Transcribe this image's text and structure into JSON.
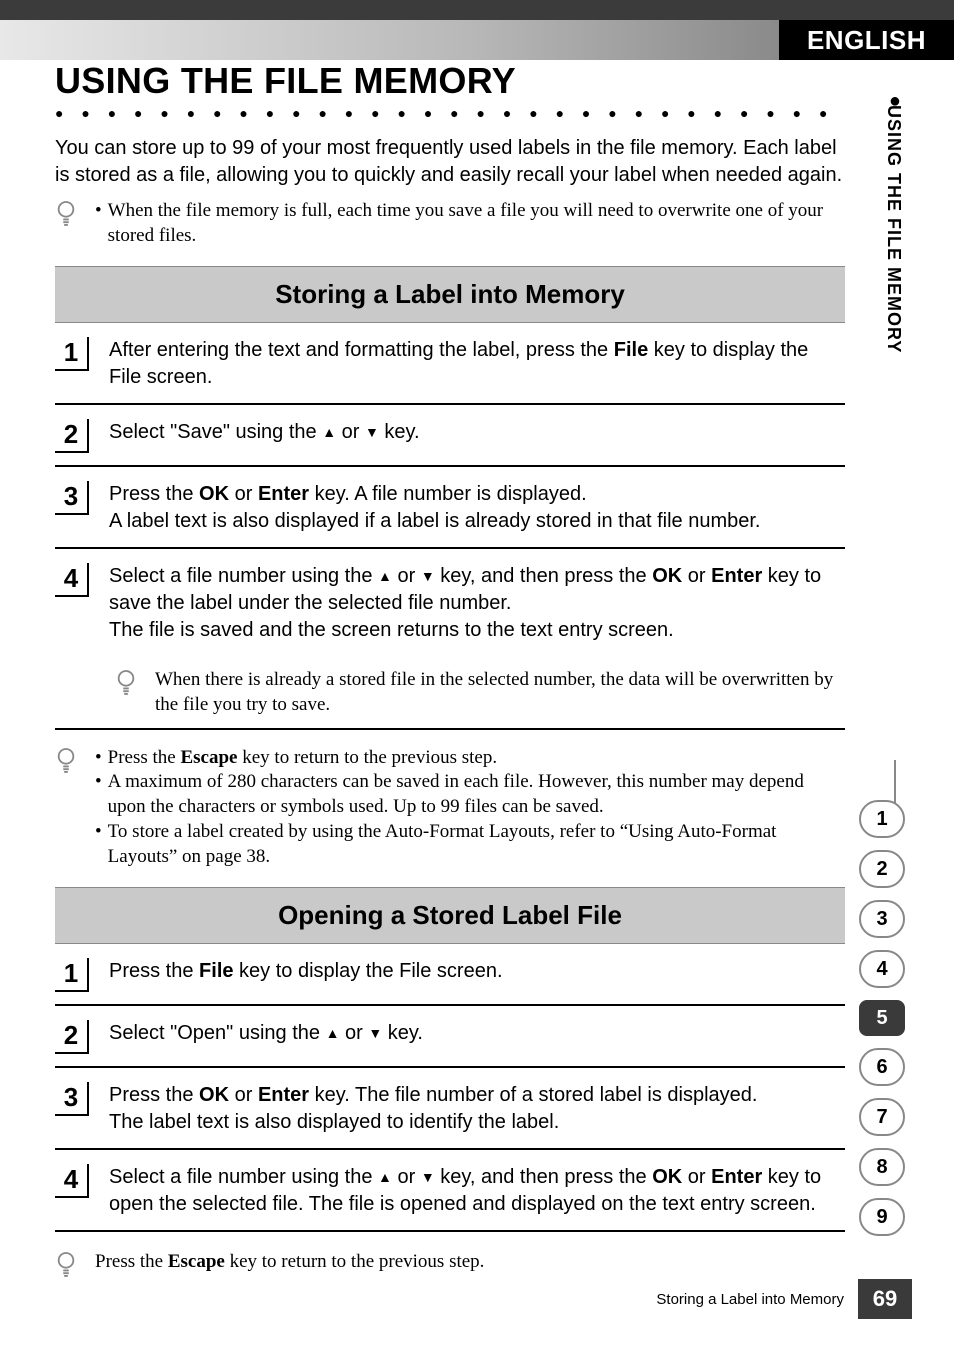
{
  "header": {
    "lang": "ENGLISH",
    "sidebar_label": "USING THE FILE MEMORY"
  },
  "title": "USING THE FILE MEMORY",
  "intro": "You can store up to 99 of your most frequently used labels in the file memory. Each label is stored as a file, allowing you to quickly and easily recall your label when needed again.",
  "intro_note": "When the file memory is full, each time you save a file you will need to overwrite one of your stored files.",
  "sectionA": {
    "title": "Storing a Label into Memory",
    "steps": [
      {
        "n": "1",
        "pre": "After entering the text and formatting the label, press the ",
        "b1": "File",
        "post": " key to display the File screen."
      },
      {
        "n": "2",
        "pre": "Select \"Save\" using the ",
        "mid": " or ",
        "post": " key."
      },
      {
        "n": "3",
        "pre": "Press the ",
        "b1": "OK",
        "mid1": " or ",
        "b2": "Enter",
        "post": " key. A file number is displayed.",
        "line2": "A label text is also displayed if a label is already stored in that file number."
      },
      {
        "n": "4",
        "pre": "Select a file number using the ",
        "mid": " or ",
        "mid2": " key, and then press the ",
        "b1": "OK",
        "mid3": " or ",
        "b2": "Enter",
        "post": " key to save the label under the selected file number.",
        "line2": "The file is saved and the screen returns to the text entry screen."
      }
    ],
    "sub_note": "When there is already a stored file in the selected number, the data will be overwritten by the file you try to save.",
    "end_notes": [
      {
        "pre": "Press the ",
        "b1": "Escape",
        "post": " key to return to the previous step."
      },
      {
        "text": "A maximum of 280 characters can be saved in each file. However, this number may depend upon the characters or symbols used. Up to 99 files can be saved."
      },
      {
        "text": "To store a label created by using the Auto-Format Layouts, refer to “Using Auto-Format Layouts” on page 38."
      }
    ]
  },
  "sectionB": {
    "title": "Opening a Stored Label File",
    "steps": [
      {
        "n": "1",
        "pre": "Press the ",
        "b1": "File",
        "post": " key to display the File screen."
      },
      {
        "n": "2",
        "pre": "Select \"Open\" using the ",
        "mid": " or ",
        "post": " key."
      },
      {
        "n": "3",
        "pre": "Press the ",
        "b1": "OK",
        "mid1": " or ",
        "b2": "Enter",
        "post": " key. The file number of a stored label is displayed.",
        "line2": "The label text is also displayed to identify the label."
      },
      {
        "n": "4",
        "pre": "Select a file number using the ",
        "mid": " or ",
        "mid2": " key, and then press the ",
        "b1": "OK",
        "mid3": " or ",
        "b2": "Enter",
        "post": " key to open the selected file. The file is opened and displayed on the text entry screen."
      }
    ],
    "end_note": {
      "pre": "Press the ",
      "b1": "Escape",
      "post": " key to return to the previous step."
    }
  },
  "tabs": [
    "1",
    "2",
    "3",
    "4",
    "5",
    "6",
    "7",
    "8",
    "9"
  ],
  "active_tab": "5",
  "footer": {
    "title": "Storing a Label into Memory",
    "page": "69"
  }
}
